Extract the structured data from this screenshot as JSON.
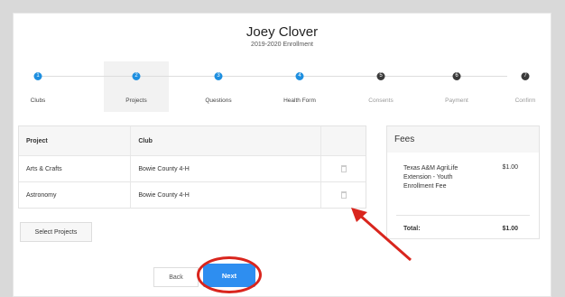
{
  "header": {
    "name": "Joey Clover",
    "enrollment": "2019-2020 Enrollment"
  },
  "steps": [
    {
      "num": "1",
      "label": "Clubs",
      "state": "done"
    },
    {
      "num": "2",
      "label": "Projects",
      "state": "active"
    },
    {
      "num": "3",
      "label": "Questions",
      "state": "done"
    },
    {
      "num": "4",
      "label": "Health Form",
      "state": "done"
    },
    {
      "num": "5",
      "label": "Consents",
      "state": "off"
    },
    {
      "num": "6",
      "label": "Payment",
      "state": "off"
    },
    {
      "num": "7",
      "label": "Confirm",
      "state": "off"
    }
  ],
  "table": {
    "headers": {
      "project": "Project",
      "club": "Club"
    },
    "rows": [
      {
        "project": "Arts & Crafts",
        "club": "Bowie County 4-H"
      },
      {
        "project": "Astronomy",
        "club": "Bowie County 4-H"
      }
    ]
  },
  "buttons": {
    "select_projects": "Select Projects",
    "back": "Back",
    "next": "Next"
  },
  "fees": {
    "title": "Fees",
    "items": [
      {
        "desc": "Texas A&M AgriLife Extension - Youth Enrollment Fee",
        "amount": "$1.00"
      }
    ],
    "total_label": "Total:",
    "total_amount": "$1.00"
  },
  "colors": {
    "accent": "#2e8ef0",
    "annotation": "#d9251d"
  },
  "icons": {
    "row_action": "trash-icon"
  }
}
